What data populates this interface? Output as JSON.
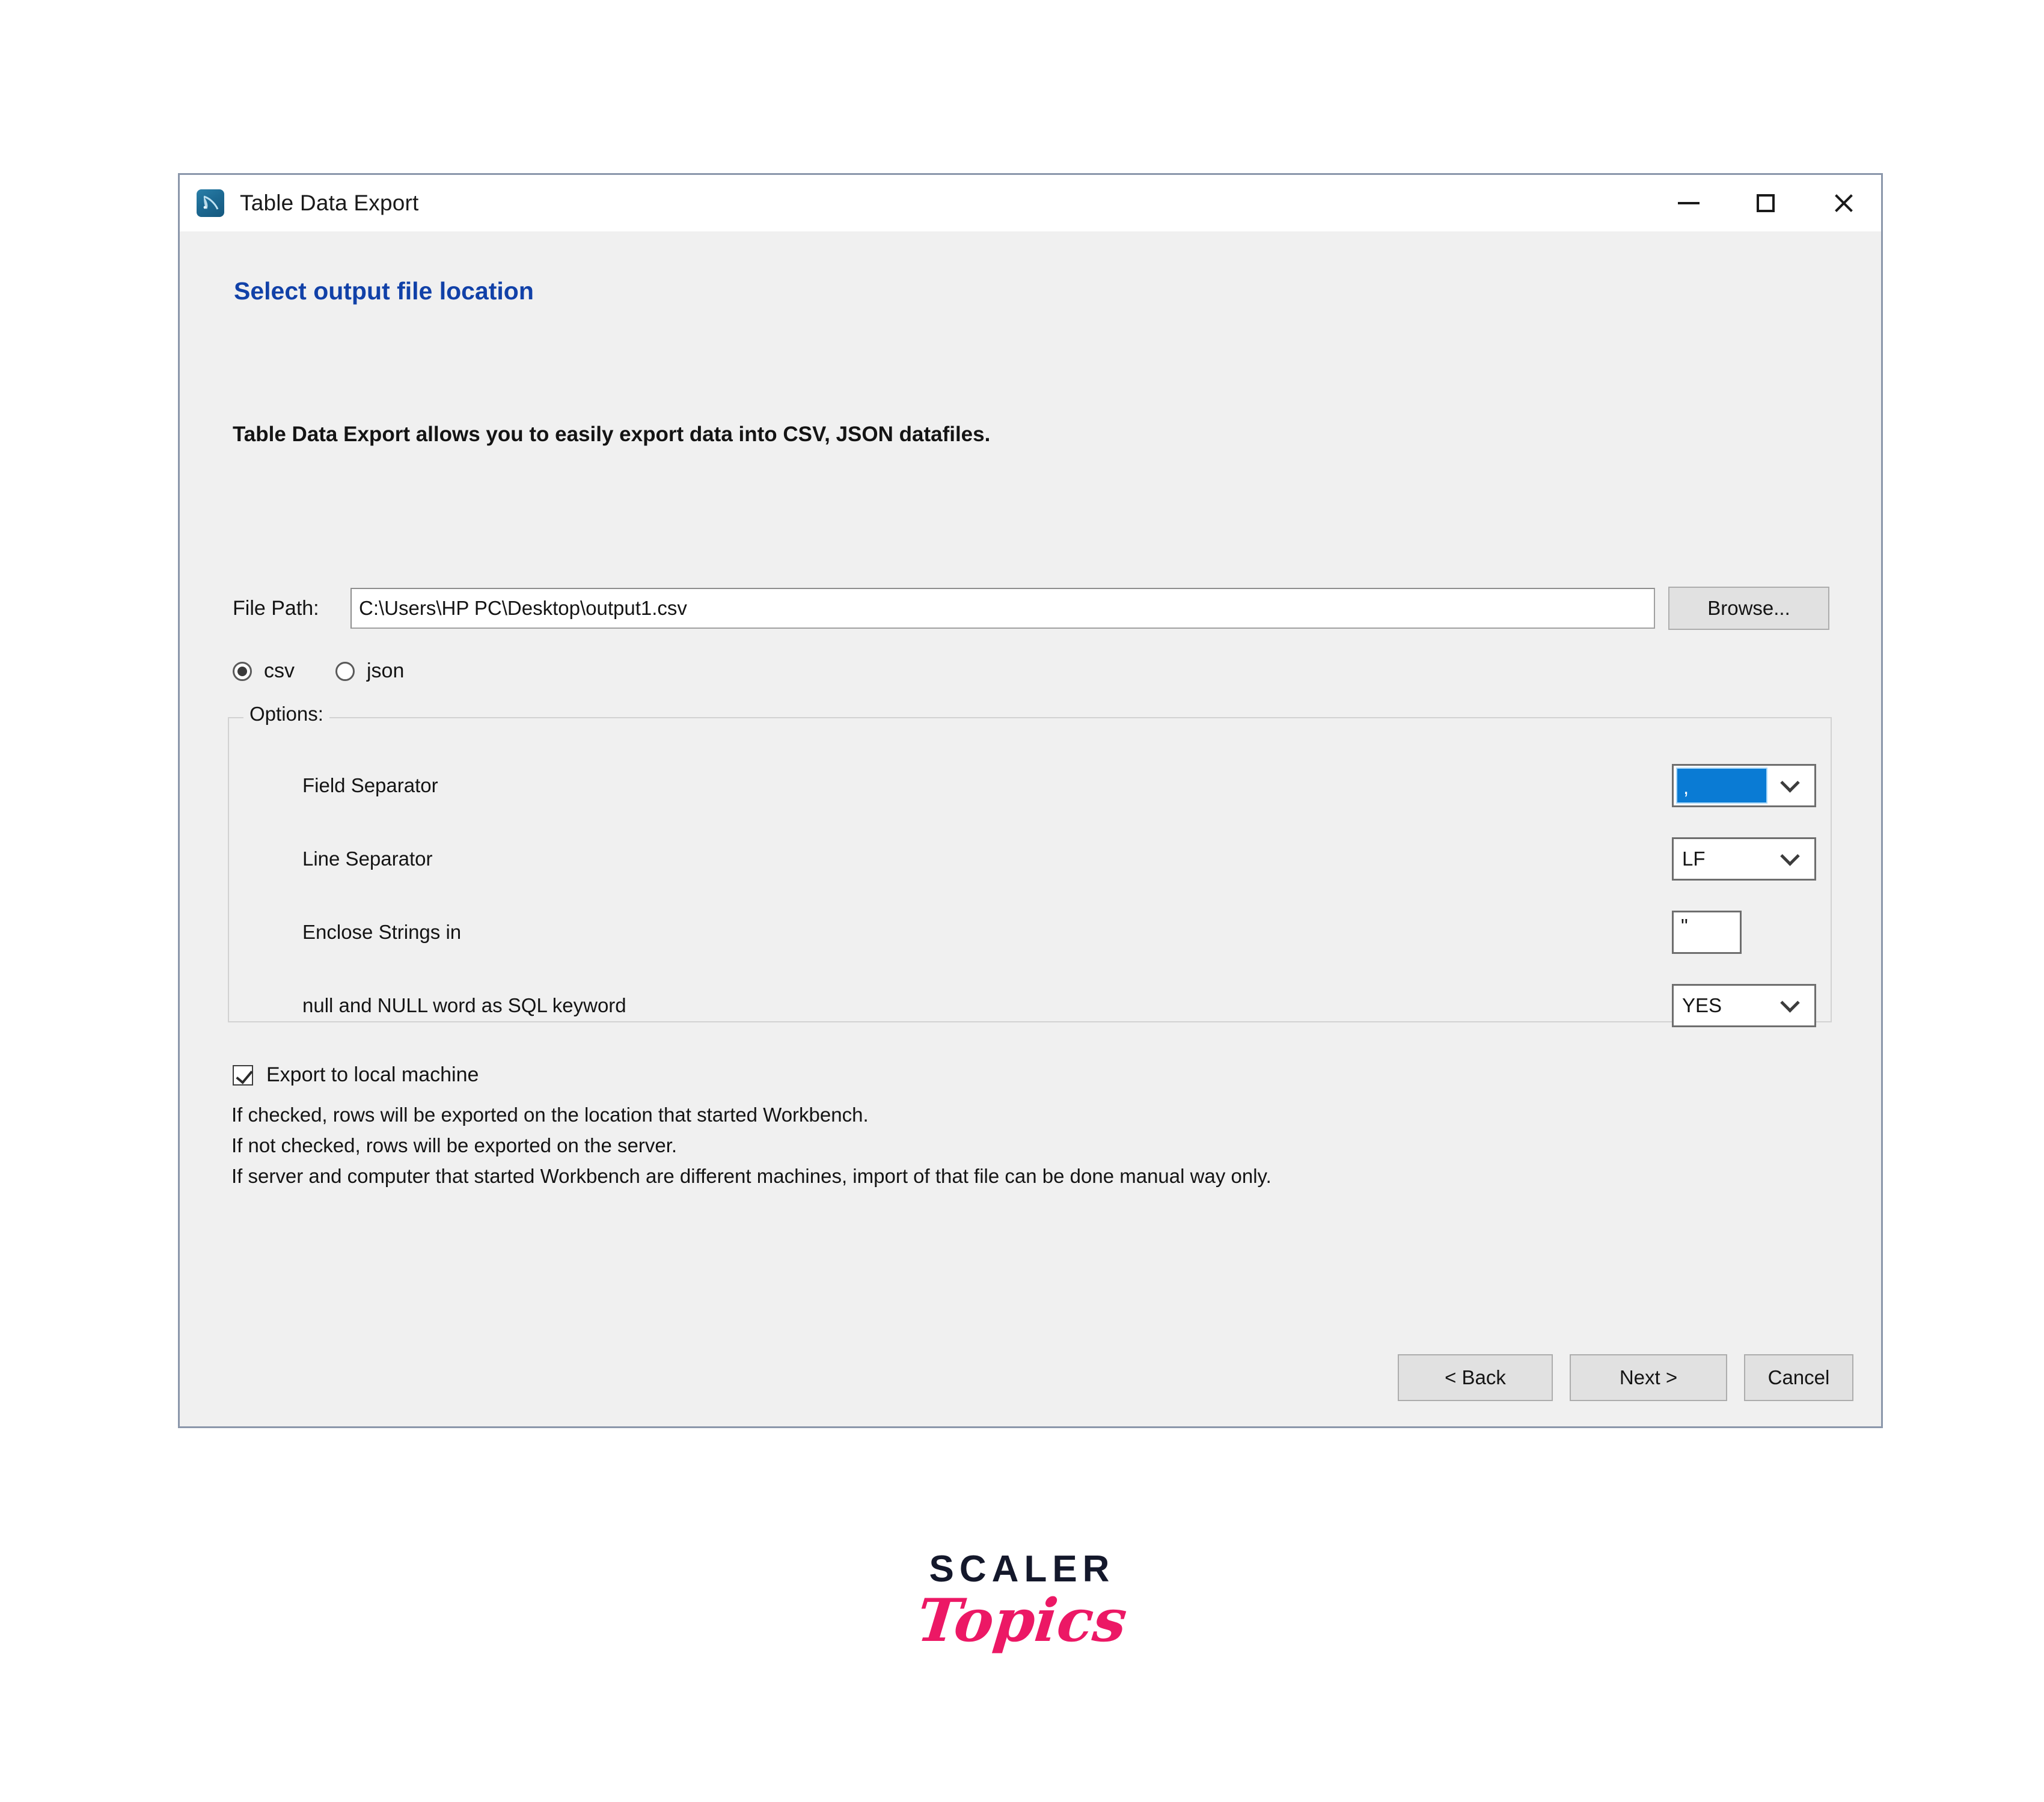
{
  "window": {
    "title": "Table Data Export",
    "app_icon": "mysql-workbench-dolphin-icon",
    "controls": {
      "minimize": "minimize-icon",
      "maximize": "maximize-icon",
      "close": "close-icon"
    }
  },
  "page": {
    "heading": "Select output file location",
    "heading_color": "#1141a8",
    "intro": "Table Data Export allows you to easily export data into CSV, JSON datafiles."
  },
  "file_path": {
    "label": "File Path:",
    "value": "C:\\Users\\HP PC\\Desktop\\output1.csv",
    "placeholder": "",
    "browse_label": "Browse..."
  },
  "format": {
    "selected": "csv",
    "options": [
      {
        "id": "csv",
        "label": "csv",
        "checked": true
      },
      {
        "id": "json",
        "label": "json",
        "checked": false
      }
    ]
  },
  "options": {
    "legend": "Options:",
    "rows": [
      {
        "label": "Field Separator",
        "control": "combo",
        "value": ",",
        "selected_highlight": true,
        "highlight_color": "#0a7bd4"
      },
      {
        "label": "Line Separator",
        "control": "combo",
        "value": "LF",
        "selected_highlight": false
      },
      {
        "label": "Enclose Strings in",
        "control": "text",
        "value": "\""
      },
      {
        "label": "null and NULL word as SQL keyword",
        "control": "combo",
        "value": "YES",
        "selected_highlight": false
      }
    ]
  },
  "export_local": {
    "label": "Export to local machine",
    "checked": true,
    "notes": [
      "If checked, rows will be exported on the location that started Workbench.",
      "If not checked, rows will be exported on the server.",
      "If server and computer that started Workbench are different machines, import of that file can be done manual way only."
    ]
  },
  "footer": {
    "back_label": "< Back",
    "next_label": "Next >",
    "cancel_label": "Cancel"
  },
  "logo": {
    "primary": "SCALER",
    "secondary": "Topics",
    "primary_color": "#14182b",
    "secondary_color": "#ec1865"
  }
}
